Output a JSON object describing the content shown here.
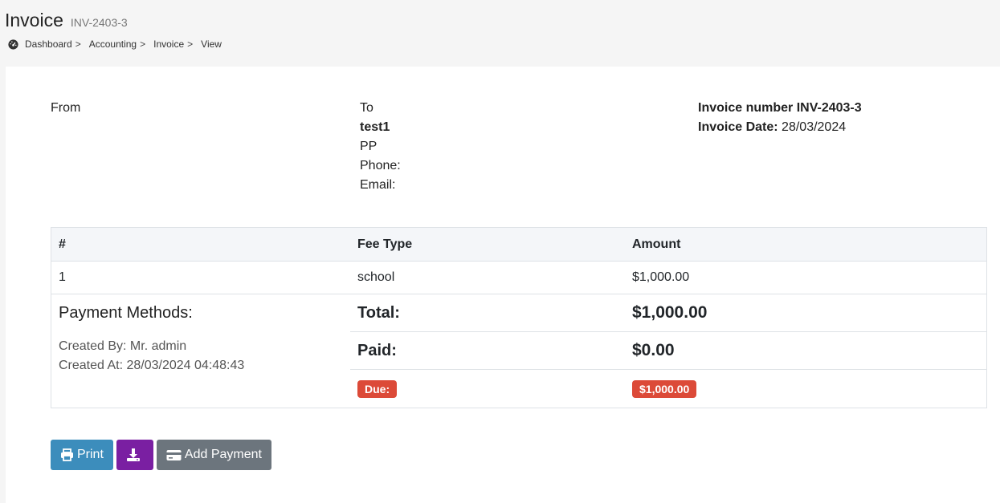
{
  "header": {
    "title": "Invoice",
    "subtitle": "INV-2403-3",
    "breadcrumb": [
      "Dashboard",
      "Accounting",
      "Invoice",
      "View"
    ],
    "separator": ">"
  },
  "from": {
    "label": "From"
  },
  "to": {
    "label": "To",
    "name": "test1",
    "line2": "PP",
    "phone": "Phone:",
    "email": "Email:"
  },
  "invoice_info": {
    "number_line": "Invoice number INV-2403-3",
    "date_label": "Invoice Date:",
    "date_value": "28/03/2024"
  },
  "table": {
    "headers": [
      "#",
      "Fee Type",
      "Amount"
    ],
    "rows": [
      {
        "num": "1",
        "fee_type": "school",
        "amount": "$1,000.00"
      }
    ]
  },
  "payment": {
    "title": "Payment Methods:",
    "created_by": "Created By: Mr. admin",
    "created_at": "Created At: 28/03/2024 04:48:43"
  },
  "summary": {
    "total_label": "Total:",
    "total_value": "$1,000.00",
    "paid_label": "Paid:",
    "paid_value": "$0.00",
    "due_label": "Due:",
    "due_value": "$1,000.00"
  },
  "actions": {
    "print_label": "Print",
    "download_icon": "download-icon",
    "payment_label": "Add Payment"
  },
  "colors": {
    "print": "#3c8dbc",
    "download": "#7a1fa2",
    "payment": "#6c757d",
    "due_badge": "#dc4a38"
  }
}
